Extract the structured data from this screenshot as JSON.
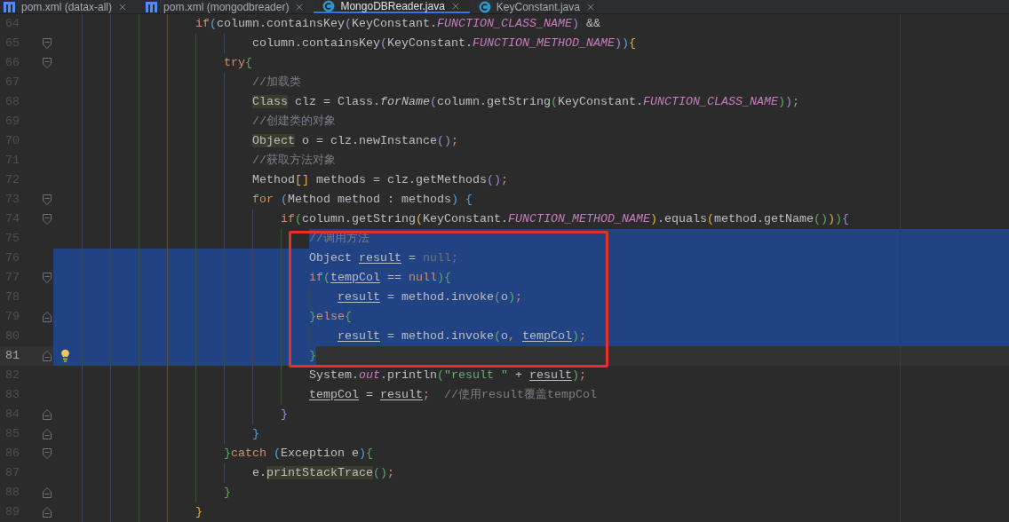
{
  "tabs": [
    {
      "label": "pom.xml (datax-all)",
      "kind": "maven",
      "selected": false
    },
    {
      "label": "pom.xml (mongodbreader)",
      "kind": "maven",
      "selected": false
    },
    {
      "label": "MongoDBReader.java",
      "kind": "java",
      "selected": true
    },
    {
      "label": "KeyConstant.java",
      "kind": "java",
      "selected": false
    }
  ],
  "editor": {
    "lines": [
      {
        "number": "64",
        "selected": false,
        "current": false,
        "bulb": false,
        "tokens": [
          {
            "text": "                    if",
            "kind": "keyword"
          },
          {
            "text": "(",
            "kind": "azure"
          },
          {
            "text": "column.containsKey",
            "kind": "plain"
          },
          {
            "text": "(",
            "kind": "violet"
          },
          {
            "text": "KeyConstant.",
            "kind": "plain"
          },
          {
            "text": "FUNCTION_CLASS_NAME",
            "kind": "constant"
          },
          {
            "text": ")",
            "kind": "violet"
          },
          {
            "text": " &&",
            "kind": "plain"
          }
        ]
      },
      {
        "number": "65",
        "selected": false,
        "current": false,
        "bulb": false,
        "fold_start": true,
        "tokens": [
          {
            "text": "                            column.containsKey",
            "kind": "plain"
          },
          {
            "text": "(",
            "kind": "violet"
          },
          {
            "text": "KeyConstant.",
            "kind": "plain"
          },
          {
            "text": "FUNCTION_METHOD_NAME",
            "kind": "constant"
          },
          {
            "text": ")",
            "kind": "violet"
          },
          {
            "text": ")",
            "kind": "azure"
          },
          {
            "text": "{",
            "kind": "gold"
          }
        ]
      },
      {
        "number": "66",
        "selected": false,
        "current": false,
        "bulb": false,
        "fold_start": true,
        "tokens": [
          {
            "text": "                        try",
            "kind": "keyword"
          },
          {
            "text": "{",
            "kind": "green"
          }
        ]
      },
      {
        "number": "67",
        "selected": false,
        "current": false,
        "bulb": false,
        "tokens": [
          {
            "text": "                            //加载类",
            "kind": "comment"
          }
        ]
      },
      {
        "number": "68",
        "selected": false,
        "current": false,
        "bulb": false,
        "tokens": [
          {
            "text": "                            Class",
            "kind": "usage"
          },
          {
            "text": " clz = Class.",
            "kind": "plain"
          },
          {
            "text": "forName",
            "kind": "static"
          },
          {
            "text": "(",
            "kind": "violet"
          },
          {
            "text": "column.getString",
            "kind": "plain"
          },
          {
            "text": "(",
            "kind": "green"
          },
          {
            "text": "KeyConstant.",
            "kind": "plain"
          },
          {
            "text": "FUNCTION_CLASS_NAME",
            "kind": "constant"
          },
          {
            "text": ")",
            "kind": "green"
          },
          {
            "text": ")",
            "kind": "violet"
          },
          {
            "text": ";",
            "kind": "keyword"
          }
        ]
      },
      {
        "number": "69",
        "selected": false,
        "current": false,
        "bulb": false,
        "tokens": [
          {
            "text": "                            //创建类的对象",
            "kind": "comment"
          }
        ]
      },
      {
        "number": "70",
        "selected": false,
        "current": false,
        "bulb": false,
        "tokens": [
          {
            "text": "                            Object",
            "kind": "usage"
          },
          {
            "text": " o = clz.newInstance",
            "kind": "plain"
          },
          {
            "text": "()",
            "kind": "violet"
          },
          {
            "text": ";",
            "kind": "keyword"
          }
        ]
      },
      {
        "number": "71",
        "selected": false,
        "current": false,
        "bulb": false,
        "tokens": [
          {
            "text": "                            //获取方法对象",
            "kind": "comment"
          }
        ]
      },
      {
        "number": "72",
        "selected": false,
        "current": false,
        "bulb": false,
        "tokens": [
          {
            "text": "                            Method",
            "kind": "plain"
          },
          {
            "text": "[]",
            "kind": "gold"
          },
          {
            "text": " methods = clz.getMethods",
            "kind": "plain"
          },
          {
            "text": "()",
            "kind": "violet"
          },
          {
            "text": ";",
            "kind": "keyword"
          }
        ]
      },
      {
        "number": "73",
        "selected": false,
        "current": false,
        "bulb": false,
        "fold_start": true,
        "tokens": [
          {
            "text": "                            for ",
            "kind": "keyword"
          },
          {
            "text": "(",
            "kind": "azure"
          },
          {
            "text": "Method method : methods",
            "kind": "plain"
          },
          {
            "text": ")",
            "kind": "azure"
          },
          {
            "text": " {",
            "kind": "azure"
          }
        ]
      },
      {
        "number": "74",
        "selected": false,
        "current": false,
        "bulb": false,
        "fold_start": true,
        "tokens": [
          {
            "text": "                                if",
            "kind": "keyword"
          },
          {
            "text": "(",
            "kind": "green"
          },
          {
            "text": "column.getString",
            "kind": "plain"
          },
          {
            "text": "(",
            "kind": "gold"
          },
          {
            "text": "KeyConstant.",
            "kind": "plain"
          },
          {
            "text": "FUNCTION_METHOD_NAME",
            "kind": "constant"
          },
          {
            "text": ")",
            "kind": "gold"
          },
          {
            "text": ".equals",
            "kind": "plain"
          },
          {
            "text": "(",
            "kind": "gold"
          },
          {
            "text": "method.getName",
            "kind": "plain"
          },
          {
            "text": "()",
            "kind": "green"
          },
          {
            "text": ")",
            "kind": "gold"
          },
          {
            "text": ")",
            "kind": "green"
          },
          {
            "text": "{",
            "kind": "violet"
          }
        ]
      },
      {
        "number": "75",
        "selected": true,
        "selection_starts_at_text": true,
        "current": false,
        "bulb": false,
        "tokens": [
          {
            "text": "                                    //调用方法",
            "kind": "comment"
          }
        ]
      },
      {
        "number": "76",
        "selected": true,
        "current": false,
        "bulb": false,
        "tokens": [
          {
            "text": "                                    Object ",
            "kind": "plain"
          },
          {
            "text": "result",
            "kind": "var"
          },
          {
            "text": " = ",
            "kind": "plain"
          },
          {
            "text": "null;",
            "kind": "dim"
          }
        ]
      },
      {
        "number": "77",
        "selected": true,
        "current": false,
        "bulb": false,
        "fold_start": true,
        "tokens": [
          {
            "text": "                                    if",
            "kind": "keyword"
          },
          {
            "text": "(",
            "kind": "green"
          },
          {
            "text": "tempCol",
            "kind": "var"
          },
          {
            "text": " == ",
            "kind": "plain"
          },
          {
            "text": "null",
            "kind": "keyword"
          },
          {
            "text": "){",
            "kind": "green"
          }
        ]
      },
      {
        "number": "78",
        "selected": true,
        "current": false,
        "bulb": false,
        "tokens": [
          {
            "text": "                                        result",
            "kind": "var"
          },
          {
            "text": " = method.invoke",
            "kind": "plain"
          },
          {
            "text": "(",
            "kind": "green"
          },
          {
            "text": "o",
            "kind": "plain"
          },
          {
            "text": ")",
            "kind": "green"
          },
          {
            "text": ";",
            "kind": "keyword"
          }
        ]
      },
      {
        "number": "79",
        "selected": true,
        "current": false,
        "bulb": false,
        "fold_end": true,
        "tokens": [
          {
            "text": "                                    }",
            "kind": "green"
          },
          {
            "text": "else",
            "kind": "keyword"
          },
          {
            "text": "{",
            "kind": "green"
          }
        ]
      },
      {
        "number": "80",
        "selected": true,
        "current": false,
        "bulb": false,
        "tokens": [
          {
            "text": "                                        result",
            "kind": "var"
          },
          {
            "text": " = method.invoke",
            "kind": "plain"
          },
          {
            "text": "(",
            "kind": "green"
          },
          {
            "text": "o",
            "kind": "plain"
          },
          {
            "text": ", ",
            "kind": "keyword"
          },
          {
            "text": "tempCol",
            "kind": "var"
          },
          {
            "text": ")",
            "kind": "green"
          },
          {
            "text": ";",
            "kind": "keyword"
          }
        ]
      },
      {
        "number": "81",
        "selected": true,
        "selection_ends_at_text": true,
        "current": true,
        "bulb": true,
        "fold_end": true,
        "tokens": [
          {
            "text": "                                    }",
            "kind": "green"
          }
        ]
      },
      {
        "number": "82",
        "selected": false,
        "current": false,
        "bulb": false,
        "tokens": [
          {
            "text": "                                    System.",
            "kind": "plain"
          },
          {
            "text": "out",
            "kind": "constant"
          },
          {
            "text": ".println",
            "kind": "plain"
          },
          {
            "text": "(",
            "kind": "green"
          },
          {
            "text": "\"result \"",
            "kind": "string"
          },
          {
            "text": " + ",
            "kind": "plain"
          },
          {
            "text": "result",
            "kind": "var"
          },
          {
            "text": ")",
            "kind": "green"
          },
          {
            "text": ";",
            "kind": "keyword"
          }
        ]
      },
      {
        "number": "83",
        "selected": false,
        "current": false,
        "bulb": false,
        "tokens": [
          {
            "text": "                                    tempCol",
            "kind": "var"
          },
          {
            "text": " = ",
            "kind": "plain"
          },
          {
            "text": "result",
            "kind": "var"
          },
          {
            "text": ";",
            "kind": "keyword"
          },
          {
            "text": "  //使用result覆盖tempCol",
            "kind": "comment"
          }
        ]
      },
      {
        "number": "84",
        "selected": false,
        "current": false,
        "bulb": false,
        "fold_end": true,
        "tokens": [
          {
            "text": "                                }",
            "kind": "violet"
          }
        ]
      },
      {
        "number": "85",
        "selected": false,
        "current": false,
        "bulb": false,
        "fold_end": true,
        "tokens": [
          {
            "text": "                            }",
            "kind": "azure"
          }
        ]
      },
      {
        "number": "86",
        "selected": false,
        "current": false,
        "bulb": false,
        "fold_start": true,
        "tokens": [
          {
            "text": "                        }",
            "kind": "green"
          },
          {
            "text": "catch ",
            "kind": "keyword"
          },
          {
            "text": "(",
            "kind": "azure"
          },
          {
            "text": "Exception e",
            "kind": "plain"
          },
          {
            "text": ")",
            "kind": "azure"
          },
          {
            "text": "{",
            "kind": "green"
          }
        ]
      },
      {
        "number": "87",
        "selected": false,
        "current": false,
        "bulb": false,
        "tokens": [
          {
            "text": "                            e.",
            "kind": "plain"
          },
          {
            "text": "printStackTrace",
            "kind": "usage"
          },
          {
            "text": "()",
            "kind": "green"
          },
          {
            "text": ";",
            "kind": "keyword"
          }
        ]
      },
      {
        "number": "88",
        "selected": false,
        "current": false,
        "bulb": false,
        "fold_end": true,
        "tokens": [
          {
            "text": "                        }",
            "kind": "green"
          }
        ]
      },
      {
        "number": "89",
        "selected": false,
        "current": false,
        "bulb": false,
        "fold_end": true,
        "tokens": [
          {
            "text": "                    }",
            "kind": "gold"
          }
        ]
      }
    ]
  }
}
